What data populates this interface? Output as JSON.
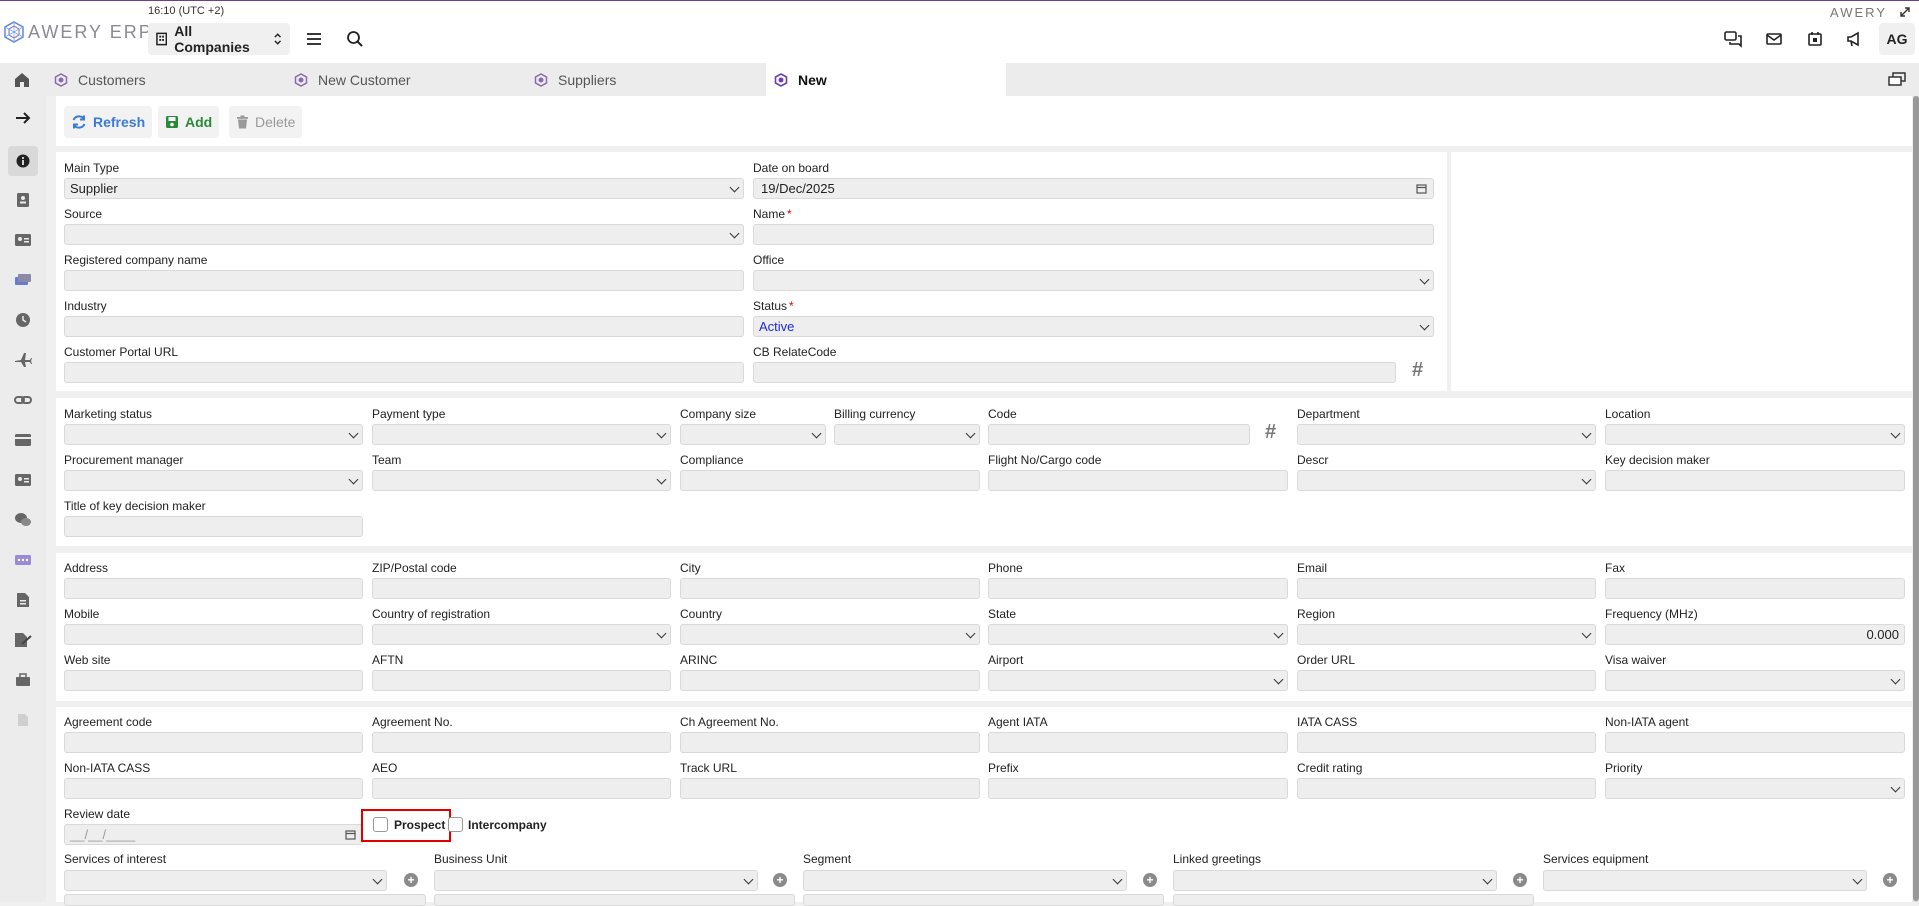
{
  "app": {
    "brand": "AWERY ERP",
    "brand_right": "AWERY",
    "clock": "16:10 (UTC +2)",
    "company_selector": "All Companies",
    "user_initials": "AG",
    "accent_color": "#6a3f8f"
  },
  "tabs": [
    {
      "label": "Customers"
    },
    {
      "label": "New Customer"
    },
    {
      "label": "Suppliers"
    },
    {
      "label": "New",
      "active": true
    }
  ],
  "toolbar": {
    "refresh": "Refresh",
    "add": "Add",
    "delete": "Delete"
  },
  "main": {
    "main_type": {
      "label": "Main Type",
      "value": "Supplier"
    },
    "date_on_board": {
      "label": "Date on board",
      "value": "19/Dec/2025"
    },
    "source": {
      "label": "Source",
      "value": ""
    },
    "name": {
      "label": "Name",
      "required": "*",
      "value": ""
    },
    "registered_company_name": {
      "label": "Registered company name",
      "value": ""
    },
    "office": {
      "label": "Office",
      "value": ""
    },
    "industry": {
      "label": "Industry",
      "value": ""
    },
    "status": {
      "label": "Status",
      "required": "*",
      "value": "Active"
    },
    "customer_portal_url": {
      "label": "Customer Portal URL",
      "value": ""
    },
    "cb_relatecode": {
      "label": "CB RelateCode",
      "value": "",
      "hash": "#"
    }
  },
  "section2": {
    "marketing_status": "Marketing status",
    "payment_type": "Payment type",
    "company_size": "Company size",
    "billing_currency": "Billing currency",
    "code": "Code",
    "code_hash": "#",
    "department": "Department",
    "location": "Location",
    "procurement_manager": "Procurement manager",
    "team": "Team",
    "compliance": "Compliance",
    "flight_no": "Flight No/Cargo code",
    "descr": "Descr",
    "key_decision_maker": "Key decision maker",
    "title_key_decision_maker": "Title of key decision maker"
  },
  "section3": {
    "address": "Address",
    "zip": "ZIP/Postal code",
    "city": "City",
    "phone": "Phone",
    "email": "Email",
    "fax": "Fax",
    "mobile": "Mobile",
    "country_of_registration": "Country of registration",
    "country": "Country",
    "state": "State",
    "region": "Region",
    "frequency": "Frequency (MHz)",
    "frequency_value": "0.000",
    "web_site": "Web site",
    "aftn": "AFTN",
    "arinc": "ARINC",
    "airport": "Airport",
    "order_url": "Order URL",
    "visa_waiver": "Visa waiver"
  },
  "section4": {
    "agreement_code": "Agreement code",
    "agreement_no": "Agreement No.",
    "ch_agreement_no": "Ch Agreement No.",
    "agent_iata": "Agent IATA",
    "iata_cass": "IATA CASS",
    "non_iata_agent": "Non-IATA agent",
    "non_iata_cass": "Non-IATA CASS",
    "aeo": "AEO",
    "track_url": "Track URL",
    "prefix": "Prefix",
    "credit_rating": "Credit rating",
    "priority": "Priority",
    "review_date": "Review date",
    "review_date_placeholder": "__/__/____",
    "prospect": "Prospect",
    "intercompany": "Intercompany",
    "services_of_interest": "Services of interest",
    "business_unit": "Business Unit",
    "segment": "Segment",
    "linked_greetings": "Linked greetings",
    "services_equipment": "Services equipment",
    "plus": "+"
  }
}
